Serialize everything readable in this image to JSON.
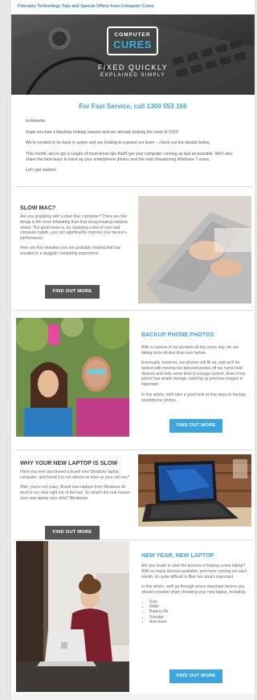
{
  "header": {
    "preheader": "February Technology Tips and Special Offers from Computer Cures"
  },
  "hero": {
    "logo_top": "COMPUTER",
    "logo_main": "CURES",
    "tagline_1": "FIXED QUICKLY",
    "tagline_2": "EXPLAINED SIMPLY"
  },
  "phone_line": "For Fast Service, call 1300 553 166",
  "intro": {
    "greeting": "Hi Annette,",
    "p1": "Hope you had a fabulous holiday season and are already making the most of 2020.",
    "p2": "We're excited to be back in action and are looking to expand our team – check out the details below.",
    "p3": "This month, we've got a couple of must-know tips that'll get your computer running as fast as possible. We'll also share the best ways to back up your smartphone photos and the risks threatening Windows 7 users.",
    "p4": "Let's get started."
  },
  "articles": [
    {
      "title": "SLOW MAC?",
      "p1": "Are you grappling with a slow Mac computer? There are few things in life more infuriating than that smug rotating rainbow wheel. The good news is, by changing a few of your bad computer habits, you can significantly improve your device's performance.",
      "p2": "Here are five mistakes you are probably making that has resulted in a sluggish computing experience.",
      "button": "FIND OUT MORE"
    },
    {
      "title": "BACKUP PHONE PHOTOS",
      "p1": "With a camera in our pockets all day every day, we are taking more photos than ever before.",
      "p2": "Eventually, however, our phones will fill up, and we'll be tasked with moving our beloved photos off our hand-held devices and onto some kind of storage system. Even if our phone has ample storage, backing up precious images is important.",
      "p3": "In this article, we'll take a good look at four ways to backup smartphone photos.",
      "button": "FIND OUT MORE"
    },
    {
      "title": "WHY YOUR NEW LAPTOP IS SLOW",
      "p1": "Have you ever purchased a brand new Windows laptop computer, and found it to run almost as slow as your old one?",
      "p2": "Well, you're not crazy. Brand new laptops from Windows do tend to run slow right out of the box. So what's the real reason your new laptop runs slow? Bloatware.",
      "button": "FIND OUT MORE"
    },
    {
      "title": "NEW YEAR, NEW LAPTOP",
      "p1": "Are you ready to start the process of buying a new laptop? With so many devices available, and more coming out each month, it's quite difficult to filter out what's important.",
      "p2": "In this article, we'll go through seven important factors you should consider when choosing your new laptop, including:",
      "list": [
        "Size",
        "RAM",
        "Battery life",
        "Storage",
        "And more"
      ],
      "button": "FIND OUT MORE"
    }
  ],
  "colors": {
    "accent_blue": "#3aa5e0",
    "dark_button": "#555555",
    "preheader_blue": "#3b7fc4"
  }
}
